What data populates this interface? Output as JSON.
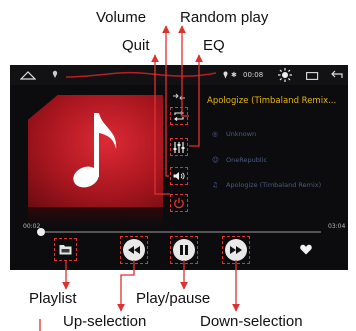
{
  "annotations": {
    "volume": "Volume",
    "random_play": "Random play",
    "quit": "Quit",
    "eq": "EQ",
    "playlist": "Playlist",
    "play_pause": "Play/pause",
    "up_selection": "Up-selection",
    "down_selection": "Down-selection"
  },
  "status": {
    "time": "00:08"
  },
  "track": {
    "title": "Apologize (Timbaland Remix...",
    "album": "Unknown",
    "artist": "OneRepublic",
    "song": "Apologize (Timbaland Remix)"
  },
  "playback": {
    "elapsed": "00:02",
    "total": "03:04",
    "progress": 0.01
  },
  "colors": {
    "accent_title": "#e6b800",
    "annotation_line": "#e0302f",
    "info_text": "#4a5b85"
  },
  "icons": [
    "home-icon",
    "location-icon",
    "bluetooth-icon",
    "brightness-icon",
    "window-icon",
    "back-icon",
    "music-note-icon",
    "random-play-icon",
    "eq-icon",
    "volume-icon",
    "power-icon",
    "playlist-icon",
    "previous-icon",
    "pause-icon",
    "next-icon",
    "heart-icon"
  ]
}
